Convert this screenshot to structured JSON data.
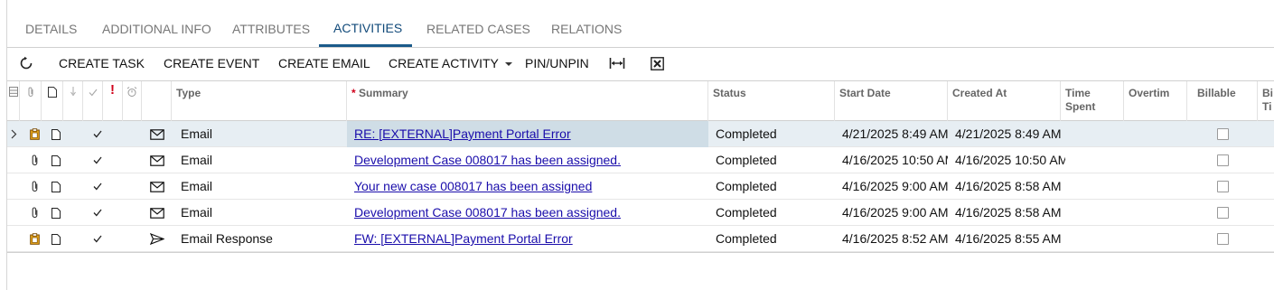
{
  "tabs": [
    {
      "label": "DETAILS"
    },
    {
      "label": "ADDITIONAL INFO"
    },
    {
      "label": "ATTRIBUTES"
    },
    {
      "label": "ACTIVITIES"
    },
    {
      "label": "RELATED CASES"
    },
    {
      "label": "RELATIONS"
    }
  ],
  "active_tab": "ACTIVITIES",
  "toolbar": {
    "refresh_icon": "refresh-icon",
    "create_task": "CREATE TASK",
    "create_event": "CREATE EVENT",
    "create_email": "CREATE EMAIL",
    "create_activity": "CREATE ACTIVITY",
    "pin_unpin": "PIN/UNPIN",
    "fit_icon": "fit-columns-icon",
    "export_icon": "export-excel-icon"
  },
  "columns": {
    "type": "Type",
    "summary_required": "*",
    "summary": "Summary",
    "status": "Status",
    "start_date": "Start Date",
    "created_at": "Created At",
    "time_spent_1": "Time",
    "time_spent_2": "Spent",
    "overtime": "Overtim",
    "billable": "Billable",
    "billable_time_1": "Bi",
    "billable_time_2": "Ti"
  },
  "rows": [
    {
      "type": "Email",
      "summary": "RE: [EXTERNAL]Payment Portal Error",
      "status": "Completed",
      "start_date": "4/21/2025 8:49 AM",
      "created_at": "4/21/2025 8:49 AM",
      "attachment": "clipboard-icon",
      "type_icon": "envelope-icon"
    },
    {
      "type": "Email",
      "summary": "Development Case 008017 has been assigned.",
      "status": "Completed",
      "start_date": "4/16/2025 10:50 AM",
      "created_at": "4/16/2025 10:50 AM",
      "attachment": "paperclip-icon",
      "type_icon": "envelope-icon"
    },
    {
      "type": "Email",
      "summary": "Your new case 008017 has been assigned",
      "status": "Completed",
      "start_date": "4/16/2025 9:00 AM",
      "created_at": "4/16/2025 8:58 AM",
      "attachment": "paperclip-icon",
      "type_icon": "envelope-icon"
    },
    {
      "type": "Email",
      "summary": "Development Case 008017 has been assigned.",
      "status": "Completed",
      "start_date": "4/16/2025 9:00 AM",
      "created_at": "4/16/2025 8:58 AM",
      "attachment": "paperclip-icon",
      "type_icon": "envelope-icon"
    },
    {
      "type": "Email Response",
      "summary": "FW: [EXTERNAL]Payment Portal Error",
      "status": "Completed",
      "start_date": "4/16/2025 8:52 AM",
      "created_at": "4/16/2025 8:55 AM",
      "attachment": "clipboard-icon",
      "type_icon": "send-icon"
    }
  ],
  "colors": {
    "accent": "#1a5a8a",
    "link": "#1a0dab",
    "required": "#d0021b",
    "selected_row": "#e7eef3"
  }
}
